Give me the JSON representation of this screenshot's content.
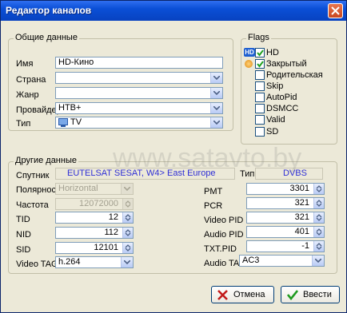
{
  "window": {
    "title": "Редактор каналов"
  },
  "general": {
    "legend": "Общие данные",
    "name_label": "Имя",
    "name_value": "HD-Кино",
    "country_label": "Страна",
    "country_value": "",
    "genre_label": "Жанр",
    "genre_value": "",
    "provider_label": "Провайдер",
    "provider_value": "НТВ+",
    "type_label": "Тип",
    "type_value": "TV"
  },
  "flags": {
    "legend": "Flags",
    "items": [
      {
        "label": "HD",
        "checked": true
      },
      {
        "label": "Закрытый",
        "checked": true
      },
      {
        "label": "Родительская бло",
        "checked": false
      },
      {
        "label": "Skip",
        "checked": false
      },
      {
        "label": "AutoPid",
        "checked": false
      },
      {
        "label": "DSMCC",
        "checked": false
      },
      {
        "label": "Valid",
        "checked": false
      },
      {
        "label": "SD",
        "checked": false
      }
    ]
  },
  "other": {
    "legend": "Другие данные",
    "satellite_label": "Спутник",
    "satellite_value": "EUTELSAT SESAT, W4> East Europe",
    "type_label": "Тип",
    "type_value": "DVBS",
    "polarity_label": "Полярность",
    "polarity_value": "Horizontal",
    "freq_label": "Частота",
    "freq_value": "12072000",
    "tid_label": "TID",
    "tid_value": "12",
    "nid_label": "NID",
    "nid_value": "112",
    "sid_label": "SID",
    "sid_value": "12101",
    "videotag_label": "Video TAG",
    "videotag_value": "h.264",
    "pmt_label": "PMT",
    "pmt_value": "3301",
    "pcr_label": "PCR",
    "pcr_value": "321",
    "videopid_label": "Video PID",
    "videopid_value": "321",
    "audiopid_label": "Audio PID",
    "audiopid_value": "401",
    "txtpid_label": "TXT.PID",
    "txtpid_value": "-1",
    "audiotag_label": "Audio TAG",
    "audiotag_value": "AC3"
  },
  "buttons": {
    "cancel": "Отмена",
    "ok": "Ввести"
  },
  "watermark": "www.satavto.by"
}
